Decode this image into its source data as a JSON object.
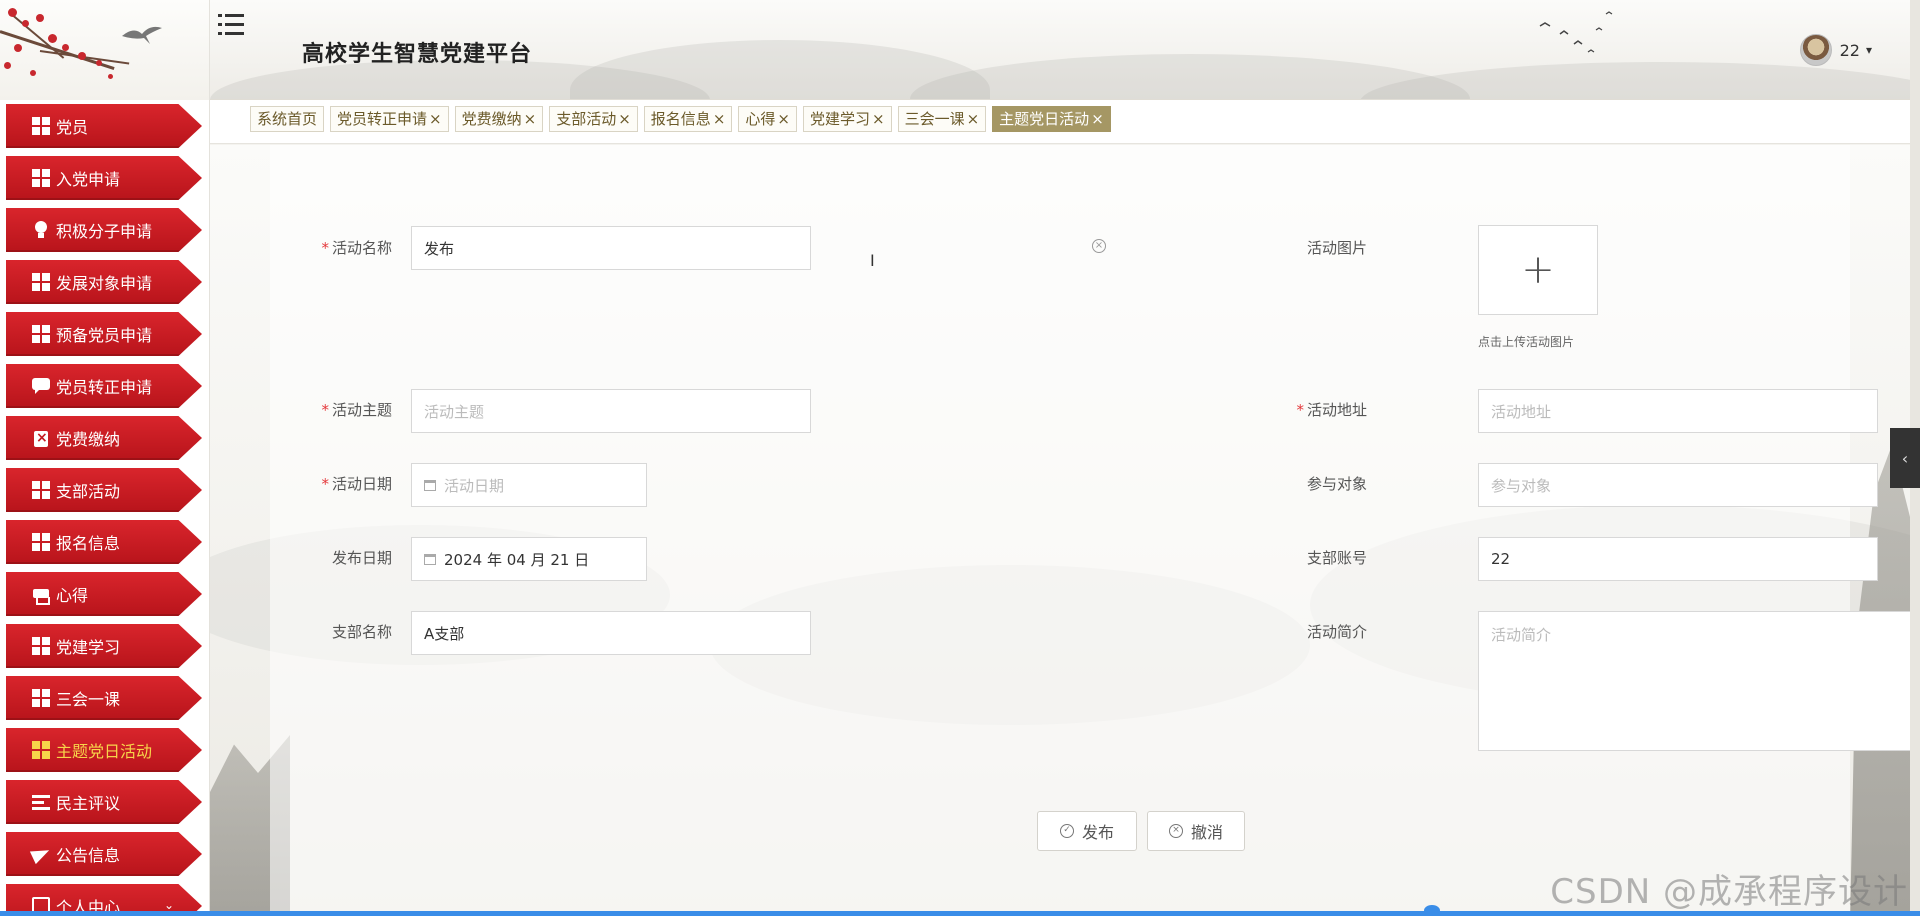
{
  "header": {
    "title": "高校学生智慧党建平台",
    "user_name": "22",
    "caret": "▾"
  },
  "sidebar": {
    "items": [
      {
        "label": "党员",
        "icon": "grid-icon"
      },
      {
        "label": "入党申请",
        "icon": "grid-icon"
      },
      {
        "label": "积极分子申请",
        "icon": "bulb-icon"
      },
      {
        "label": "发展对象申请",
        "icon": "grid-icon"
      },
      {
        "label": "预备党员申请",
        "icon": "grid-icon"
      },
      {
        "label": "党员转正申请",
        "icon": "chat-icon"
      },
      {
        "label": "党费缴纳",
        "icon": "clipboard-icon"
      },
      {
        "label": "支部活动",
        "icon": "grid-icon"
      },
      {
        "label": "报名信息",
        "icon": "grid-icon"
      },
      {
        "label": "心得",
        "icon": "printer-icon"
      },
      {
        "label": "党建学习",
        "icon": "grid-icon"
      },
      {
        "label": "三会一课",
        "icon": "grid-icon"
      },
      {
        "label": "主题党日活动",
        "icon": "grid-icon",
        "active": true
      },
      {
        "label": "民主评议",
        "icon": "list-icon"
      },
      {
        "label": "公告信息",
        "icon": "paper-plane-icon"
      },
      {
        "label": "个人中心",
        "icon": "card-icon",
        "chevron": "⌄"
      }
    ]
  },
  "tabs": [
    {
      "label": "系统首页",
      "closable": false
    },
    {
      "label": "党员转正申请",
      "closable": true
    },
    {
      "label": "党费缴纳",
      "closable": true
    },
    {
      "label": "支部活动",
      "closable": true
    },
    {
      "label": "报名信息",
      "closable": true
    },
    {
      "label": "心得",
      "closable": true
    },
    {
      "label": "党建学习",
      "closable": true
    },
    {
      "label": "三会一课",
      "closable": true
    },
    {
      "label": "主题党日活动",
      "closable": true,
      "active": true
    }
  ],
  "tab_close_glyph": "×",
  "form": {
    "activity_name": {
      "label": "活动名称",
      "value": "发布",
      "required": true
    },
    "activity_image": {
      "label": "活动图片",
      "tip": "点击上传活动图片",
      "plus": "+"
    },
    "activity_theme": {
      "label": "活动主题",
      "placeholder": "活动主题",
      "required": true
    },
    "activity_address": {
      "label": "活动地址",
      "placeholder": "活动地址",
      "required": true
    },
    "activity_date": {
      "label": "活动日期",
      "placeholder": "活动日期",
      "required": true
    },
    "participants": {
      "label": "参与对象",
      "placeholder": "参与对象"
    },
    "publish_date": {
      "label": "发布日期",
      "value": "2024 年 04 月 21 日"
    },
    "branch_account": {
      "label": "支部账号",
      "value": "22"
    },
    "branch_name": {
      "label": "支部名称",
      "value": "A支部"
    },
    "activity_intro": {
      "label": "活动简介",
      "placeholder": "活动简介"
    },
    "required_mark": "*",
    "clear_glyph": "×",
    "cursor_glyph": "I"
  },
  "buttons": {
    "publish": "发布",
    "publish_glyph": "✓",
    "cancel": "撤消",
    "cancel_glyph": "×"
  },
  "side_toggle_glyph": "‹",
  "watermark": "CSDN @成承程序设计",
  "colors": {
    "menu_red": "#c41a21",
    "menu_active_text": "#f7d44a",
    "tab_active_bg": "#a59764",
    "tab_text": "#6b5a2a",
    "required": "#e4393c"
  }
}
